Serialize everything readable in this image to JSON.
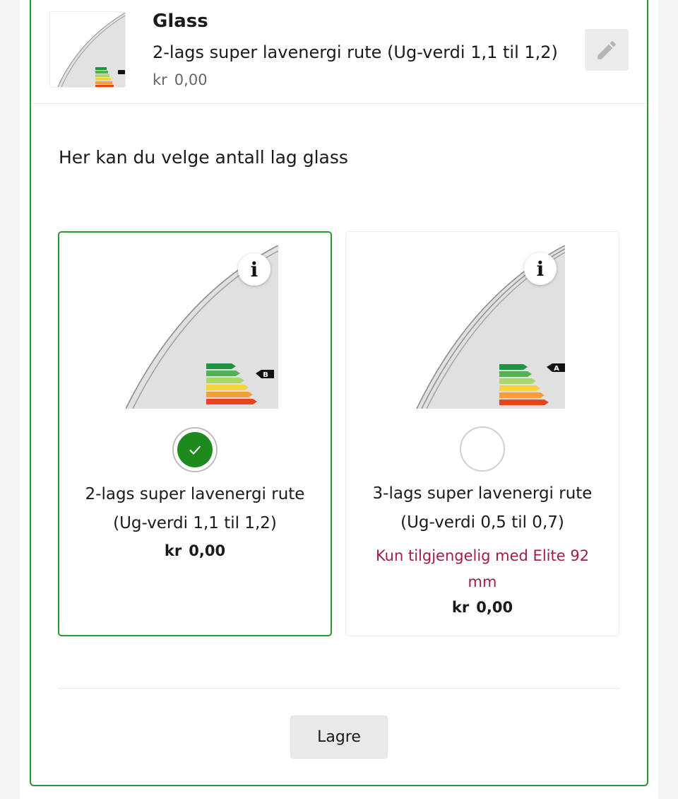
{
  "header": {
    "thumbnail_icon": "glass-energy-label-thumbnail",
    "title": "Glass",
    "description": "2-lags super lavenergi rute (Ug-verdi 1,1 til 1,2)",
    "currency": "kr",
    "price": "0,00",
    "edit_icon": "pencil-icon"
  },
  "section": {
    "prompt": "Her kan du velge antall lag glass"
  },
  "options": [
    {
      "label_line1": "2-lags super lavenergi rute",
      "label_line2": "(Ug-verdi 1,1 til 1,2)",
      "currency": "kr",
      "price": "0,00",
      "energy_class": "B",
      "selected": true,
      "info_label": "i"
    },
    {
      "label_line1": "3-lags super lavenergi rute",
      "label_line2": "(Ug-verdi 0,5 til 0,7)",
      "note": "Kun tilgjengelig med Elite 92 mm",
      "currency": "kr",
      "price": "0,00",
      "energy_class": "A",
      "selected": false,
      "info_label": "i"
    }
  ],
  "footer": {
    "save_label": "Lagre"
  },
  "colors": {
    "accent_green": "#2a9a2a",
    "selected_fill": "#1e8a1e",
    "note_red": "#a01d46"
  }
}
